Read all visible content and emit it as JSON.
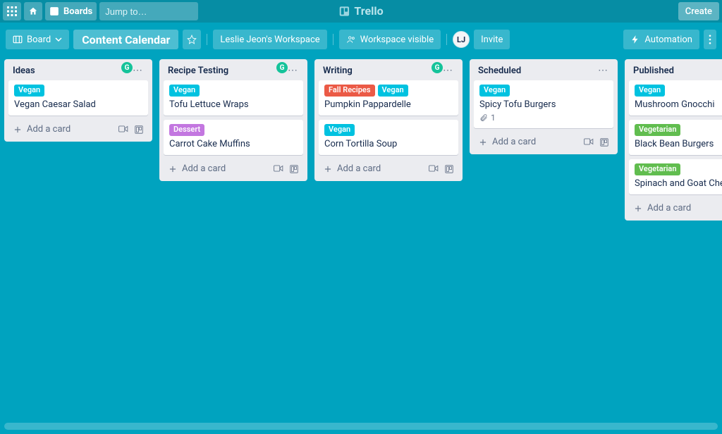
{
  "header": {
    "boards_label": "Boards",
    "search_placeholder": "Jump to…",
    "logo_text": "Trello",
    "create_label": "Create"
  },
  "boardbar": {
    "view_label": "Board",
    "board_title": "Content Calendar",
    "workspace_label": "Leslie Jeon's Workspace",
    "visibility_label": "Workspace visible",
    "avatar_initials": "LJ",
    "invite_label": "Invite",
    "automation_label": "Automation"
  },
  "labels": {
    "vegan": "Vegan",
    "dessert": "Dessert",
    "fall": "Fall Recipes",
    "vegetarian": "Vegetarian"
  },
  "add_card_label": "Add a card",
  "lists": [
    {
      "title": "Ideas",
      "show_g": true,
      "show_add_icons": true,
      "cards": [
        {
          "labels": [
            "vegan"
          ],
          "title": "Vegan Caesar Salad"
        }
      ]
    },
    {
      "title": "Recipe Testing",
      "show_g": true,
      "show_add_icons": true,
      "cards": [
        {
          "labels": [
            "vegan"
          ],
          "title": "Tofu Lettuce Wraps"
        },
        {
          "labels": [
            "dessert"
          ],
          "title": "Carrot Cake Muffins"
        }
      ]
    },
    {
      "title": "Writing",
      "show_g": true,
      "show_add_icons": true,
      "cards": [
        {
          "labels": [
            "fall",
            "vegan"
          ],
          "title": "Pumpkin Pappardelle"
        },
        {
          "labels": [
            "vegan"
          ],
          "title": "Corn Tortilla Soup"
        }
      ]
    },
    {
      "title": "Scheduled",
      "show_g": false,
      "show_add_icons": true,
      "cards": [
        {
          "labels": [
            "vegan"
          ],
          "title": "Spicy Tofu Burgers",
          "attachments": "1"
        }
      ]
    },
    {
      "title": "Published",
      "show_g": false,
      "show_add_icons": false,
      "cards": [
        {
          "labels": [
            "vegan"
          ],
          "title": "Mushroom Gnocchi"
        },
        {
          "labels": [
            "vegetarian"
          ],
          "title": "Black Bean Burgers"
        },
        {
          "labels": [
            "vegetarian"
          ],
          "title": "Spinach and Goat Cheese Q"
        }
      ]
    }
  ]
}
